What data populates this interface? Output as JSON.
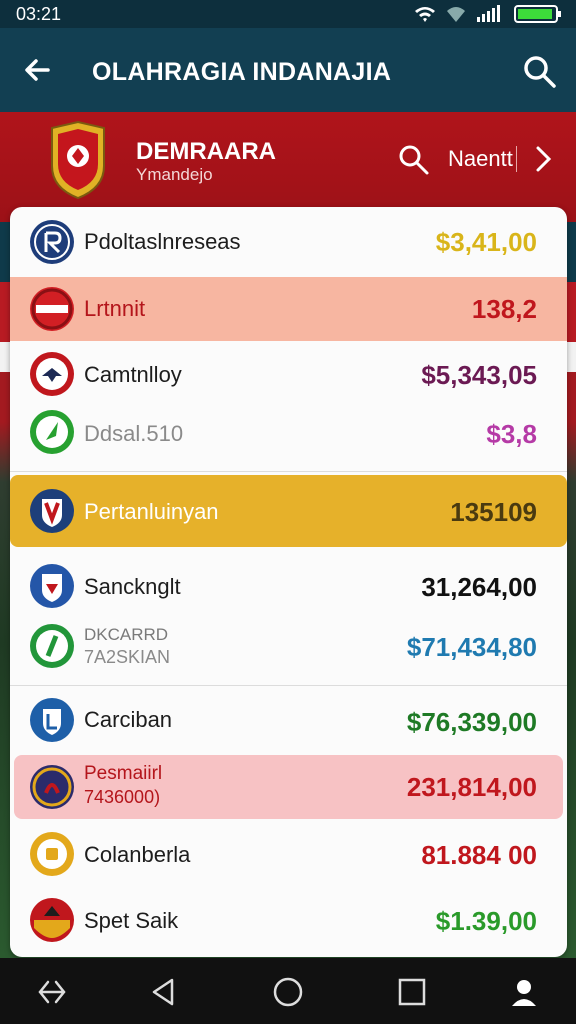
{
  "status": {
    "time": "03:21"
  },
  "appbar": {
    "title": "OLAHRAGIA INDANAJIA"
  },
  "hero": {
    "name": "DEMRAARA",
    "subtitle": "Ymandejo",
    "link": "Naentt"
  },
  "rows": [
    {
      "name": "Pdoltaslnreseas",
      "amount": "$3,41,00",
      "amount_color": "#d9b51a",
      "icon_color": "#1e3d7a",
      "icon_glyph": "R",
      "highlight": "none"
    },
    {
      "name": "Lrtnnit",
      "amount": "138,2",
      "amount_color": "#c0171d",
      "icon_color": "#d21f24",
      "icon_glyph": "",
      "highlight": "#f7b6a1"
    },
    {
      "name": "Camtnlloy",
      "amount": "$5,343,05",
      "amount_color": "#6b1a53",
      "icon_color": "#c0171d",
      "icon_glyph": "",
      "highlight": "none"
    },
    {
      "name": "Ddsal.510",
      "amount": "$3,8",
      "amount_color": "#b53aa6",
      "icon_color": "#27a130",
      "icon_glyph": "",
      "highlight": "none",
      "muted": true
    },
    {
      "name": "Pertanluinyan",
      "amount": "135109",
      "amount_color": "#4a3a10",
      "icon_color": "#1d3f7a",
      "icon_glyph": "",
      "highlight": "#e6b12a"
    },
    {
      "name": "Sancknglt",
      "amount": "31,264,00",
      "amount_color": "#111111",
      "icon_color": "#2456a8",
      "icon_glyph": "",
      "highlight": "none"
    },
    {
      "name": "DKCARRD",
      "sub": "7A2SKIAN",
      "amount": "$71,434,80",
      "amount_color": "#1f7ab0",
      "icon_color": "#22963a",
      "icon_glyph": "",
      "highlight": "none"
    },
    {
      "name": "Carciban",
      "amount": "$76,339,00",
      "amount_color": "#1e7a25",
      "icon_color": "#1e5fa8",
      "icon_glyph": "",
      "highlight": "none"
    },
    {
      "name": "Pesmaiirl",
      "sub": "7436000)",
      "amount": "231,814,00",
      "amount_color": "#c0171d",
      "icon_color": "#2b2b6b",
      "icon_glyph": "",
      "highlight": "#f7c2c4"
    },
    {
      "name": "Colanberla",
      "amount": "81.884 00",
      "amount_color": "#c0171d",
      "icon_color": "#e3a81b",
      "icon_glyph": "",
      "highlight": "none"
    },
    {
      "name": "Spet Saik",
      "amount": "$1.39,00",
      "amount_color": "#2a9a2a",
      "icon_color": "#c0171d",
      "icon_glyph": "",
      "highlight": "none"
    }
  ]
}
